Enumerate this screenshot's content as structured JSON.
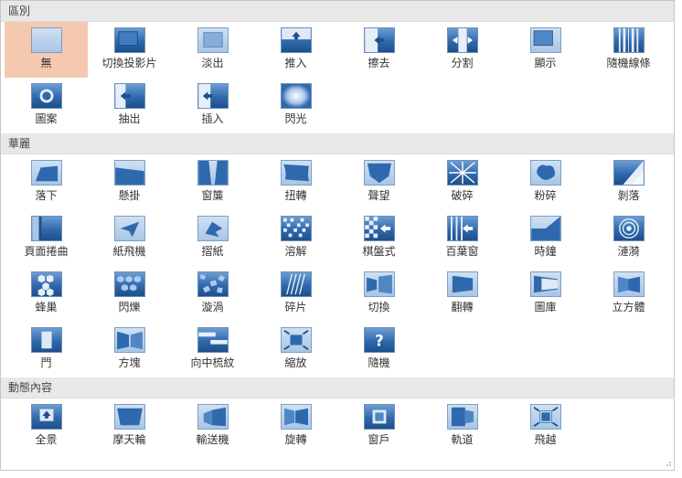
{
  "sections": [
    {
      "title": "區別",
      "items": [
        {
          "label": "無",
          "icon": "none-icon",
          "selected": true
        },
        {
          "label": "切換投影片",
          "icon": "cut-icon"
        },
        {
          "label": "淡出",
          "icon": "fade-icon"
        },
        {
          "label": "推入",
          "icon": "push-icon"
        },
        {
          "label": "擦去",
          "icon": "wipe-icon"
        },
        {
          "label": "分割",
          "icon": "split-icon"
        },
        {
          "label": "顯示",
          "icon": "reveal-icon"
        },
        {
          "label": "隨機線條",
          "icon": "random-bars-icon"
        },
        {
          "label": "圖案",
          "icon": "shape-icon"
        },
        {
          "label": "抽出",
          "icon": "uncover-icon"
        },
        {
          "label": "插入",
          "icon": "cover-icon"
        },
        {
          "label": "閃光",
          "icon": "flash-icon"
        }
      ]
    },
    {
      "title": "華麗",
      "items": [
        {
          "label": "落下",
          "icon": "fall-over-icon"
        },
        {
          "label": "懸掛",
          "icon": "drape-icon"
        },
        {
          "label": "窗簾",
          "icon": "curtains-icon"
        },
        {
          "label": "扭轉",
          "icon": "wind-icon"
        },
        {
          "label": "聲望",
          "icon": "prestige-icon"
        },
        {
          "label": "破碎",
          "icon": "fracture-icon"
        },
        {
          "label": "粉碎",
          "icon": "crush-icon"
        },
        {
          "label": "剝落",
          "icon": "peel-off-icon"
        },
        {
          "label": "頁面捲曲",
          "icon": "page-curl-icon"
        },
        {
          "label": "紙飛機",
          "icon": "airplane-icon"
        },
        {
          "label": "摺紙",
          "icon": "origami-icon"
        },
        {
          "label": "溶解",
          "icon": "dissolve-icon"
        },
        {
          "label": "棋盤式",
          "icon": "checkerboard-icon"
        },
        {
          "label": "百葉窗",
          "icon": "blinds-icon"
        },
        {
          "label": "時鐘",
          "icon": "clock-icon"
        },
        {
          "label": "漣漪",
          "icon": "ripple-icon"
        },
        {
          "label": "蜂巢",
          "icon": "honeycomb-icon"
        },
        {
          "label": "閃爍",
          "icon": "glitter-icon"
        },
        {
          "label": "漩渦",
          "icon": "vortex-icon"
        },
        {
          "label": "碎片",
          "icon": "shred-icon"
        },
        {
          "label": "切換",
          "icon": "switch-icon"
        },
        {
          "label": "翻轉",
          "icon": "flip-icon"
        },
        {
          "label": "圖庫",
          "icon": "gallery-icon"
        },
        {
          "label": "立方體",
          "icon": "cube-icon"
        },
        {
          "label": "門",
          "icon": "doors-icon"
        },
        {
          "label": "方塊",
          "icon": "box-icon"
        },
        {
          "label": "向中梳紋",
          "icon": "comb-icon"
        },
        {
          "label": "縮放",
          "icon": "zoom-icon"
        },
        {
          "label": "隨機",
          "icon": "random-icon"
        }
      ]
    },
    {
      "title": "動態內容",
      "items": [
        {
          "label": "全景",
          "icon": "pan-icon"
        },
        {
          "label": "摩天輪",
          "icon": "ferris-wheel-icon"
        },
        {
          "label": "輸送機",
          "icon": "conveyor-icon"
        },
        {
          "label": "旋轉",
          "icon": "rotate-icon"
        },
        {
          "label": "窗戶",
          "icon": "window-icon"
        },
        {
          "label": "軌道",
          "icon": "orbit-icon"
        },
        {
          "label": "飛越",
          "icon": "fly-through-icon"
        }
      ]
    }
  ]
}
